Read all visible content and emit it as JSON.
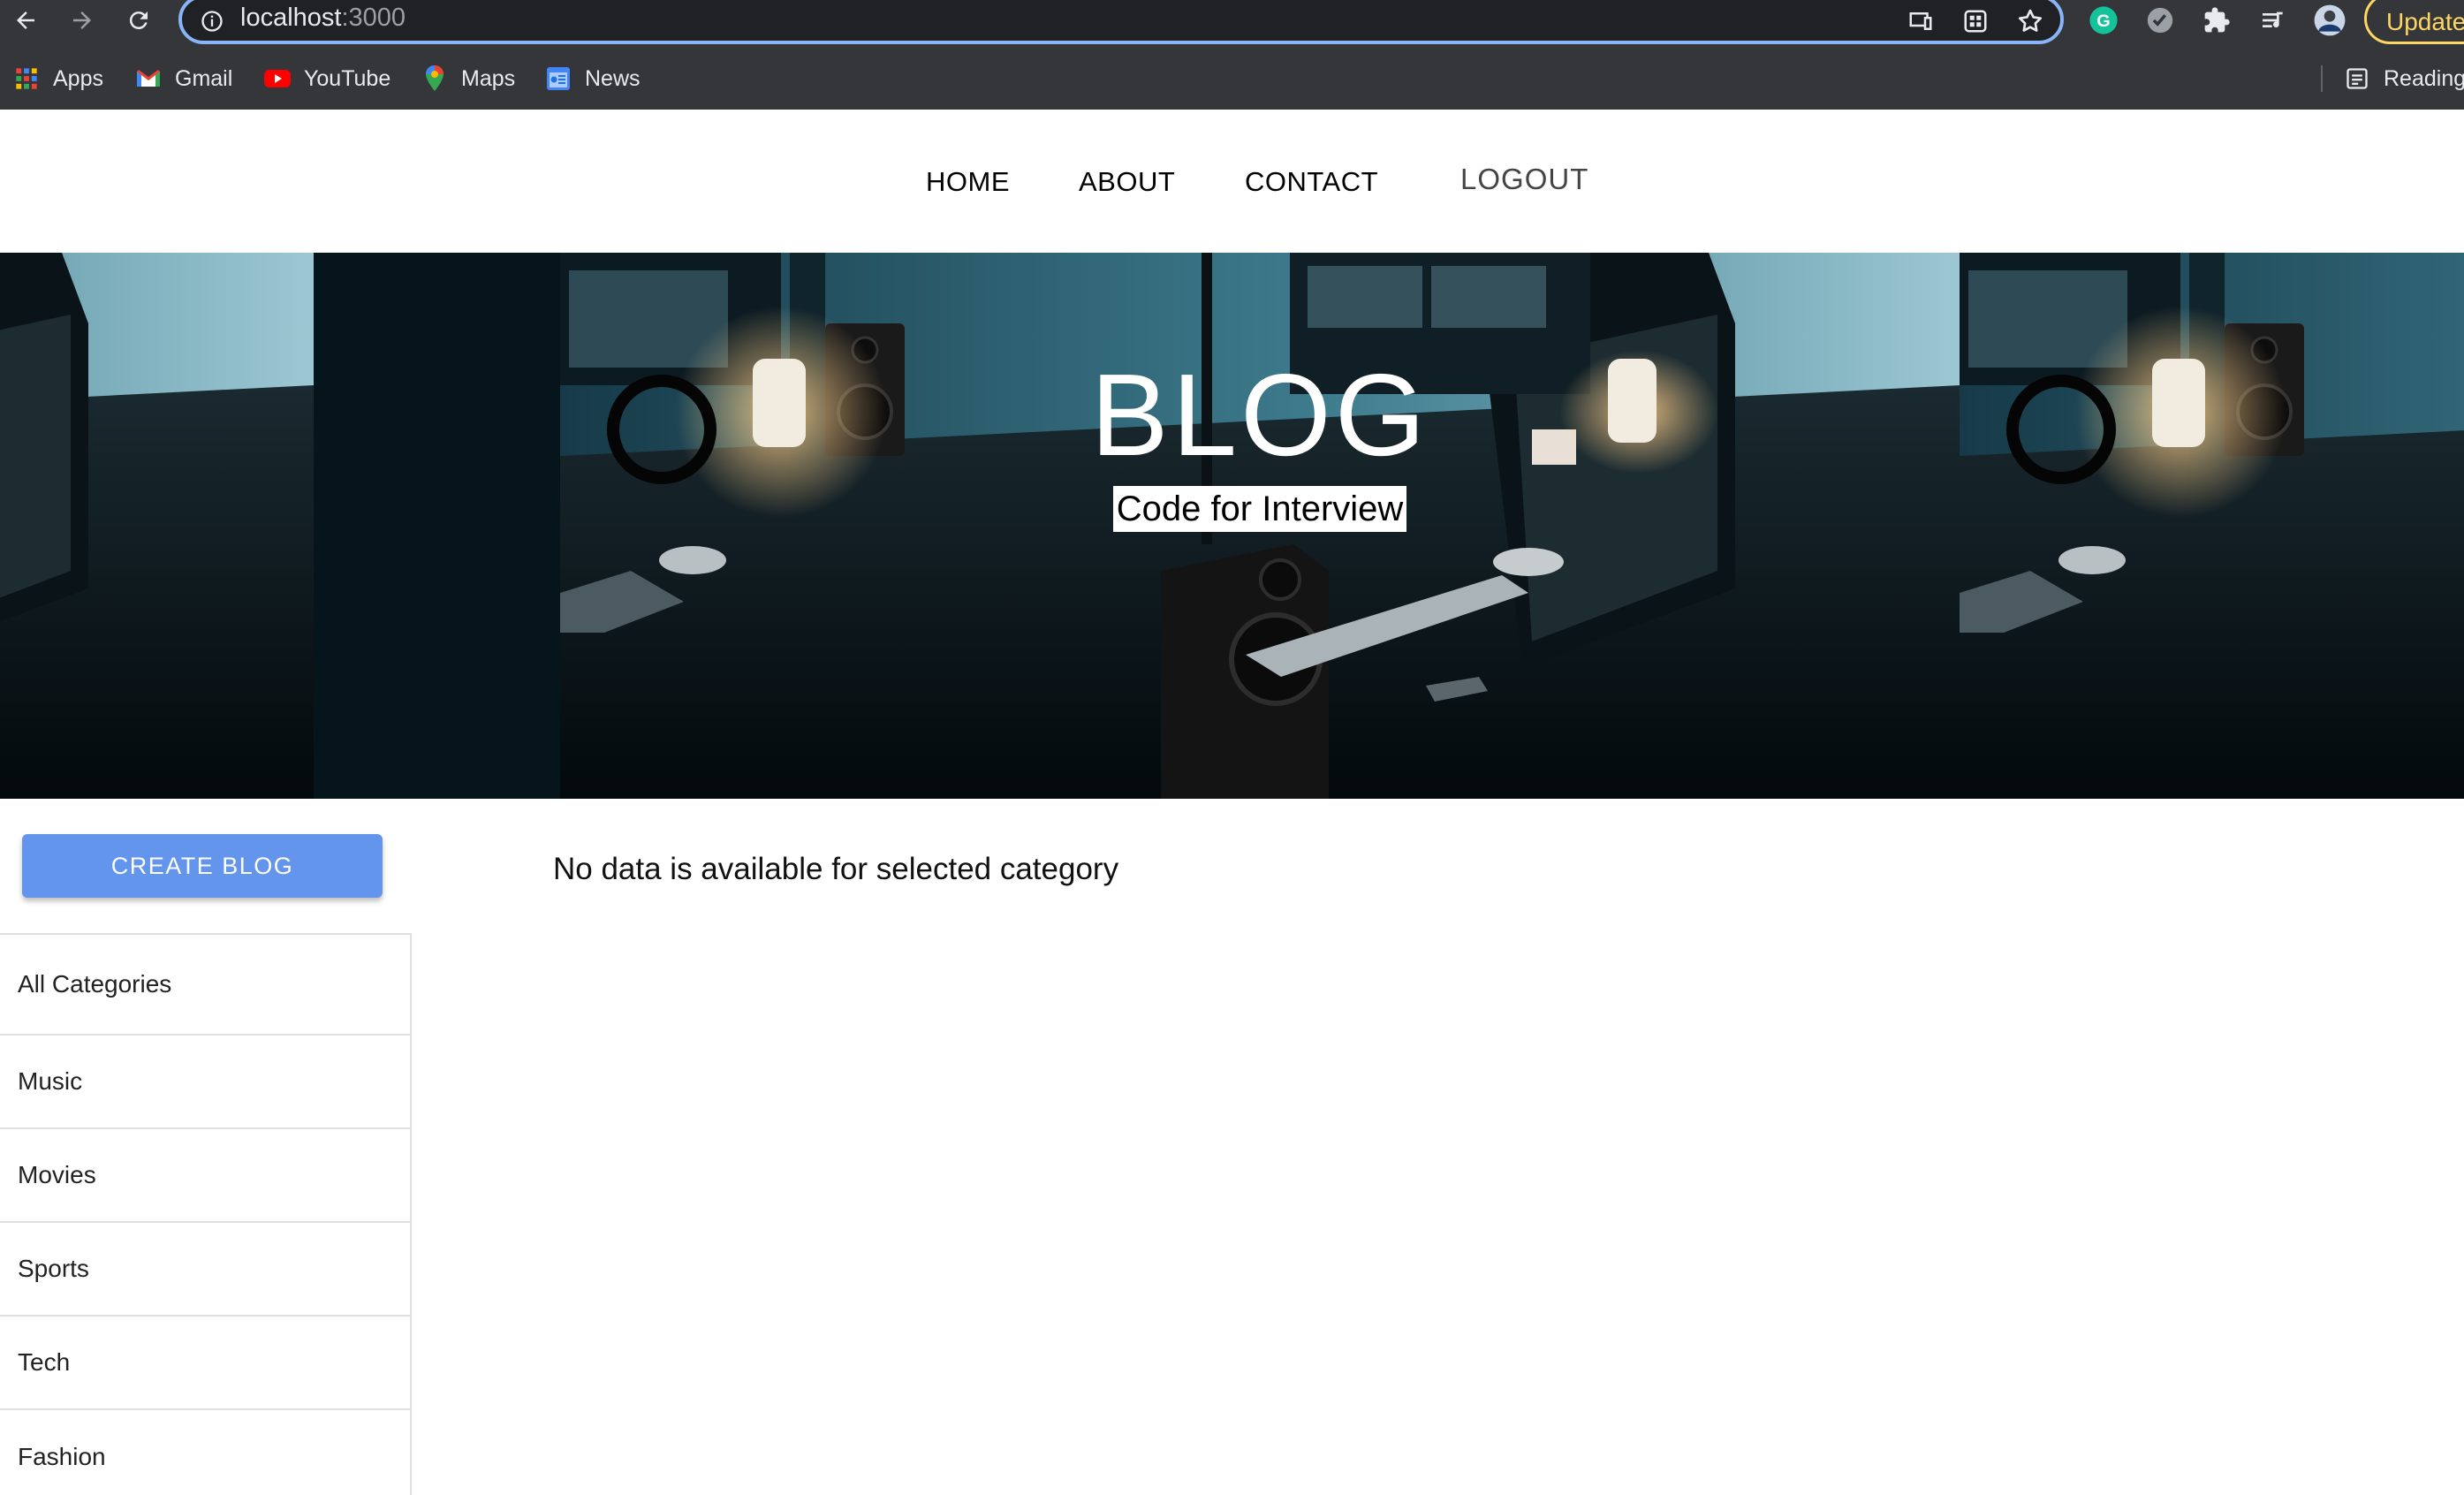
{
  "browser": {
    "url_host": "localhost",
    "url_port": ":3000",
    "update_label": "Update",
    "bookmarks": [
      {
        "label": "Apps",
        "icon": "apps-grid-icon"
      },
      {
        "label": "Gmail",
        "icon": "gmail-icon"
      },
      {
        "label": "YouTube",
        "icon": "youtube-icon"
      },
      {
        "label": "Maps",
        "icon": "maps-icon"
      },
      {
        "label": "News",
        "icon": "news-icon"
      }
    ],
    "reading_list_label": "Reading"
  },
  "nav": {
    "home": "HOME",
    "about": "ABOUT",
    "contact": "CONTACT",
    "logout": "LOGOUT"
  },
  "banner": {
    "title": "BLOG",
    "subtitle": "Code for Interview"
  },
  "sidebar": {
    "create_label": "CREATE BLOG",
    "categories": [
      "All Categories",
      "Music",
      "Movies",
      "Sports",
      "Tech",
      "Fashion"
    ]
  },
  "main": {
    "empty_message": "No data is available for selected category"
  },
  "colors": {
    "create_button": "#6495ed",
    "chrome_bg": "#35363a",
    "update_accent": "#fdd663"
  }
}
